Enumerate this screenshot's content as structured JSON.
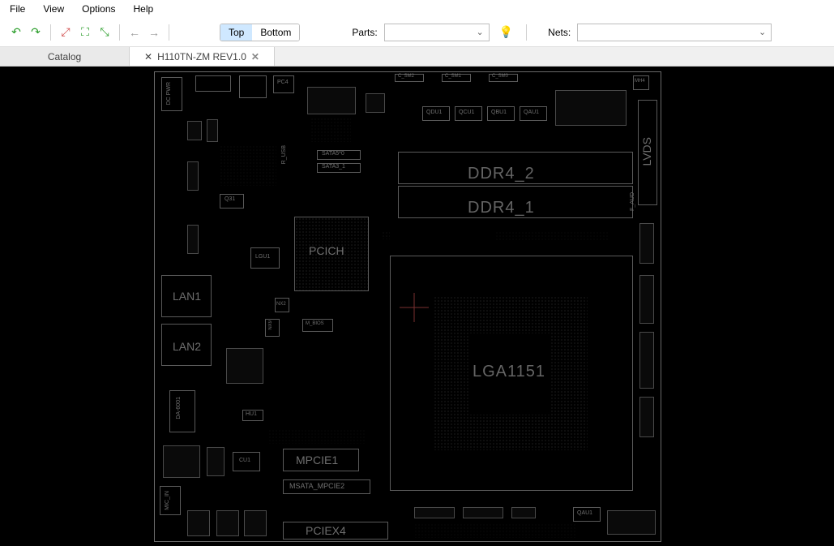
{
  "menu": {
    "file": "File",
    "view": "View",
    "options": "Options",
    "help": "Help"
  },
  "toolbar": {
    "layer_top": "Top",
    "layer_bottom": "Bottom",
    "parts_label": "Parts:",
    "nets_label": "Nets:"
  },
  "tabs": {
    "catalog": "Catalog",
    "board": "H110TN-ZM REV1.0"
  },
  "pcb_labels": {
    "dc_pwr": "DC PWR",
    "pc4": "PC4",
    "c_sm2": "C_SM2",
    "c_sm1": "C_SM1",
    "c_sm0": "C_SM0",
    "mh4": "MH4",
    "qdu1": "QDU1",
    "qcu1": "QCU1",
    "qbu1": "QBU1",
    "qau1": "QAU1",
    "lvds": "LVDS",
    "sata5_0": "SATA5*0",
    "sata3_1": "SATA3_1",
    "ddr4_2": "DDR4_2",
    "ddr4_1": "DDR4_1",
    "q31": "Q31",
    "pcich": "PCICH",
    "lgu1": "LGU1",
    "nx2": "NX2",
    "nx9": "NX9",
    "m_bios": "M_BIOS",
    "lan1": "LAN1",
    "lan2": "LAN2",
    "lga1151": "LGA1151",
    "da6001": "DA-6001",
    "hu1": "HU1",
    "cu1": "CU1",
    "mpcie1": "MPCIE1",
    "msata": "MSATA_MPCIE2",
    "mic_in": "MIC_IN",
    "pciex4": "PCIEX4",
    "r_usb": "R_USB",
    "f_aud": "F_AUD",
    "lgu": "LGU",
    "qau": "QAU1"
  }
}
